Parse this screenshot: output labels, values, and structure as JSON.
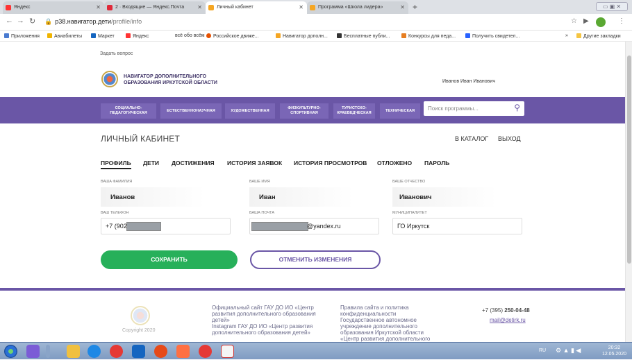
{
  "browser": {
    "tabs": [
      {
        "title": "Яндекс",
        "icon": "yandex-icon",
        "color": "#ff3333",
        "active": false
      },
      {
        "title": "2 · Входящие — Яндекс.Почта",
        "icon": "mail-icon",
        "color": "#e0293a",
        "active": false
      },
      {
        "title": "Личный кабинет",
        "icon": "navigator-icon",
        "color": "#f5a623",
        "active": true
      },
      {
        "title": "Программа «Школа лидера»",
        "icon": "navigator-icon",
        "color": "#f5a623",
        "active": false
      }
    ],
    "new_tab": "+",
    "url_host": "p38.навигатор.дети",
    "url_path": "/profile/info",
    "bookmarks": [
      "Приложения",
      "Авиабилеты",
      "Маркет",
      "Яндекс",
      "всё обо всём",
      "Российское движе...",
      "Навигатор дополн...",
      "Бесплатные публи...",
      "Конкурсы для педа...",
      "Получить свидетел..."
    ],
    "other_bookmarks": "Другие закладки",
    "more": "»"
  },
  "site": {
    "ask_question": "Задать вопрос",
    "logo_line1": "НАВИГАТОР ДОПОЛНИТЕЛЬНОГО",
    "logo_line2": "ОБРАЗОВАНИЯ ИРКУТСКОЙ ОБЛАСТИ",
    "user_name": "Иванов Иван Иванович",
    "categories": [
      "СОЦИАЛЬНО-ПЕДАГОГИЧЕСКАЯ",
      "ЕСТЕСТВЕННОНАУЧНАЯ",
      "ХУДОЖЕСТВЕННАЯ",
      "ФИЗКУЛЬТУРНО-СПОРТИВНАЯ",
      "ТУРИСТСКО-КРАЕВЕДЧЕСКАЯ",
      "ТЕХНИЧЕСКАЯ"
    ],
    "search_placeholder": "Поиск программы..."
  },
  "cabinet": {
    "title": "ЛИЧНЫЙ КАБИНЕТ",
    "catalog_link": "В КАТАЛОГ",
    "logout_link": "ВЫХОД",
    "tabs": [
      "ПРОФИЛЬ",
      "ДЕТИ",
      "ДОСТИЖЕНИЯ",
      "ИСТОРИЯ ЗАЯВОК",
      "ИСТОРИЯ ПРОСМОТРОВ",
      "ОТЛОЖЕНО",
      "ПАРОЛЬ"
    ],
    "active_tab": "ПРОФИЛЬ",
    "fields": {
      "surname_label": "ВАША ФАМИЛИЯ",
      "surname": "Иванов",
      "name_label": "ВАШЕ ИМЯ",
      "name": "Иван",
      "patronymic_label": "ВАШЕ ОТЧЕСТВО",
      "patronymic": "Иванович",
      "phone_label": "ВАШ ТЕЛЕФОН",
      "phone": "+7 (902)",
      "email_label": "ВАША ПОЧТА",
      "email": "@yandex.ru",
      "municipality_label": "МУНИЦИПАЛИТЕТ",
      "municipality": "ГО Иркутск"
    },
    "save_button": "СОХРАНИТЬ",
    "cancel_button": "ОТМЕНИТЬ ИЗМЕНЕНИЯ"
  },
  "footer": {
    "copyright": "Copyright 2020",
    "col1_line1": "Официальный сайт ГАУ ДО ИО «Центр",
    "col1_line2": "развития дополнительного образования",
    "col1_line3": "детей»",
    "col1_line4": "Instagram ГАУ ДО ИО «Центр развития",
    "col1_line5": "дополнительного образования детей»",
    "col2_line1": "Правила сайта и политика",
    "col2_line2": "конфиденциальности",
    "col2_line3": "Государственное автономное",
    "col2_line4": "учреждение дополнительного",
    "col2_line5": "образования Иркутской области",
    "col2_line6": "«Центр развития дополнительного",
    "phone_prefix": "+7 (395)",
    "phone_number": "250-04-48",
    "email": "mail@detirk.ru"
  },
  "taskbar": {
    "time": "20:32",
    "date": "12.05.2020",
    "lang": "RU"
  },
  "colors": {
    "brand": "#6a56a6",
    "save": "#27b05a"
  }
}
